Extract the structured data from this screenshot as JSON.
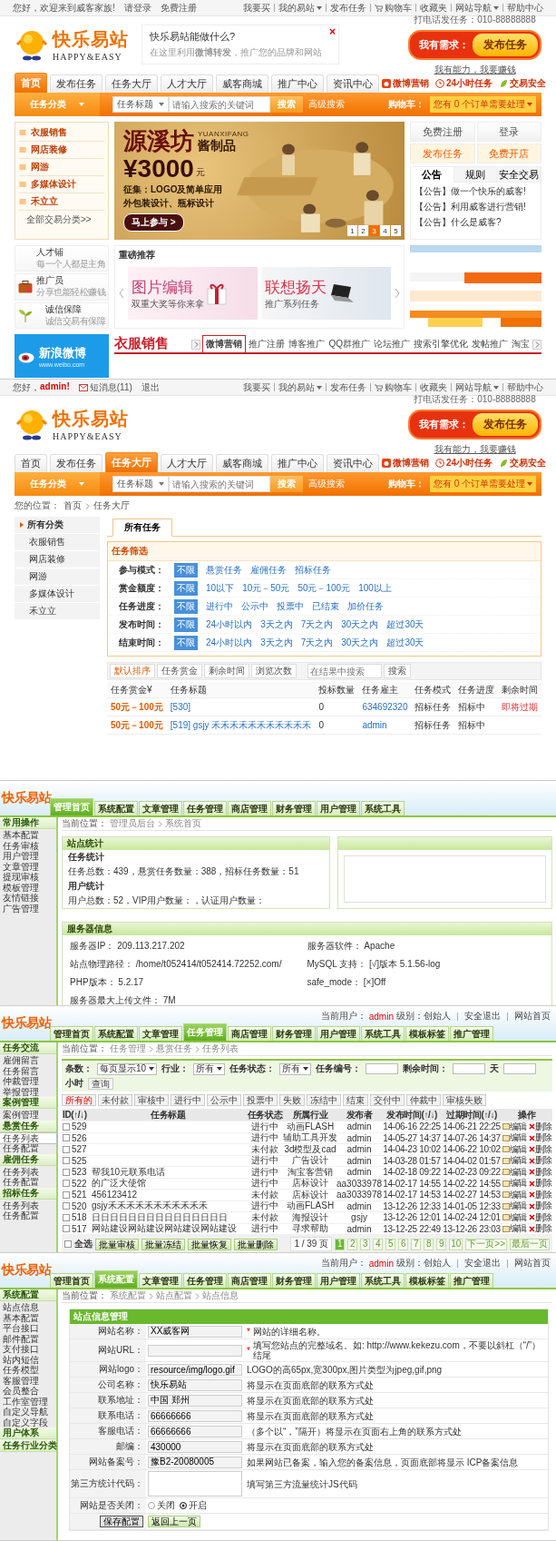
{
  "home_page": {
    "top_bar": {
      "greeting": "您好，欢迎来到威客家族!",
      "links": [
        "请登录",
        "免费注册"
      ]
    },
    "quick_links": [
      {
        "label": "我要买",
        "kind": "link",
        "dropdown": false
      },
      {
        "label": "我的易站",
        "kind": "link",
        "dropdown": true
      },
      {
        "label": "发布任务",
        "kind": "link",
        "dropdown": false
      },
      {
        "label": "购物车",
        "kind": "cart",
        "dropdown": false
      },
      {
        "label": "收藏夹",
        "kind": "link",
        "dropdown": false
      },
      {
        "label": "网站导航",
        "kind": "link",
        "dropdown": true
      },
      {
        "label": "帮助中心",
        "kind": "link",
        "dropdown": false
      }
    ],
    "header": {
      "logo": {
        "name": "快乐易站",
        "tagline": "HAPPY&EASY"
      },
      "notice": {
        "title": "快乐易站能做什么?",
        "close": "×",
        "text": "在这里利用**微博转发**，推广您的品牌和网站"
      },
      "hotline": "打电话发任务：010-88888888",
      "demand": {
        "label": "我有需求：",
        "button": "发布任务"
      },
      "earn_link": "我有能力，我要赚钱"
    },
    "nav": {
      "tabs": [
        {
          "label": "首页",
          "selected": true
        },
        {
          "label": "发布任务",
          "selected": false
        },
        {
          "label": "任务大厅",
          "selected": false
        },
        {
          "label": "人才大厅",
          "selected": false
        },
        {
          "label": "威客商城",
          "selected": false
        },
        {
          "label": "推广中心",
          "selected": false
        },
        {
          "label": "资讯中心",
          "selected": false
        }
      ],
      "badges": [
        {
          "label": "微博营销",
          "kind": "weibo"
        },
        {
          "label": "24小时任务",
          "kind": "clock"
        },
        {
          "label": "交易安全",
          "kind": "leaf"
        }
      ]
    },
    "search": {
      "category": "任务分类",
      "field_type": "任务标题",
      "placeholder": "请输入搜索的关键词",
      "button": "搜索",
      "advanced": "高级搜索",
      "cart_label": "购物车：",
      "cart_status": "您有 0 个订单需要处理"
    },
    "categories": {
      "items": [
        "衣服销售",
        "网店装修",
        "网游",
        "多媒体设计",
        "禾立立"
      ],
      "more": "全部交易分类>>"
    },
    "banner": {
      "title": "源溪坊",
      "romanized": "YUANXIFANG",
      "product": "酱制品",
      "prize": "¥3000",
      "unit": "元",
      "lines": [
        "征集：LOGO及简单应用",
        "外包装设计、瓶标设计"
      ],
      "cta": "马上参与 >",
      "pages": [
        {
          "label": "1",
          "selected": false
        },
        {
          "label": "2",
          "selected": false
        },
        {
          "label": "3",
          "selected": true
        },
        {
          "label": "4",
          "selected": false
        },
        {
          "label": "5",
          "selected": false
        }
      ]
    },
    "account_box": {
      "buttons": [
        {
          "label": "免费注册",
          "kind": "plain"
        },
        {
          "label": "登录",
          "kind": "plain"
        },
        {
          "label": "发布任务",
          "kind": "accent"
        },
        {
          "label": "免费开店",
          "kind": "accent"
        }
      ],
      "tabs": [
        {
          "label": "公告",
          "selected": true
        },
        {
          "label": "规则",
          "selected": false
        },
        {
          "label": "安全交易",
          "selected": false
        }
      ],
      "notices": [
        "【公告】做一个快乐的威客!",
        "【公告】利用威客进行营销!",
        "【公告】什么是威客?"
      ]
    },
    "features": [
      {
        "title": "人才铺",
        "subtitle": "每一个人都是主角",
        "kind": "blank"
      },
      {
        "title": "推广员",
        "subtitle": "分享也能轻松赚钱",
        "kind": "briefcase"
      },
      {
        "title": "诚信保障",
        "subtitle": "诚信交易有保障",
        "kind": "plant"
      }
    ],
    "recommend": {
      "title": "重磅推荐",
      "items": [
        {
          "title": "图片编辑",
          "subtitle": "双重大奖等你来拿",
          "kind": "gift"
        },
        {
          "title": "联想扬天",
          "subtitle": "推广系列任务",
          "kind": "laptop"
        }
      ]
    },
    "weibo": {
      "name": "新浪微博",
      "url": "www.weibo.com"
    },
    "category_strip": {
      "title": "衣服销售",
      "tabs": [
        {
          "label": "微博营销",
          "selected": true
        },
        {
          "label": "推广注册",
          "selected": false
        },
        {
          "label": "博客推广",
          "selected": false
        },
        {
          "label": "QQ群推广",
          "selected": false
        },
        {
          "label": "论坛推广",
          "selected": false
        },
        {
          "label": "搜索引擎优化",
          "selected": false
        },
        {
          "label": "发帖推广",
          "selected": false
        },
        {
          "label": "淘宝",
          "selected": false
        }
      ]
    }
  },
  "task_hall_page": {
    "top_bar": {
      "greeting": "您好，",
      "user": "admin!",
      "messages": "短消息(11)",
      "logout": "退出"
    },
    "quick_links": [
      {
        "label": "我要买",
        "kind": "link",
        "dropdown": false
      },
      {
        "label": "我的易站",
        "kind": "link",
        "dropdown": true
      },
      {
        "label": "发布任务",
        "kind": "link",
        "dropdown": false
      },
      {
        "label": "购物车",
        "kind": "cart",
        "dropdown": false
      },
      {
        "label": "收藏夹",
        "kind": "link",
        "dropdown": false
      },
      {
        "label": "网站导航",
        "kind": "link",
        "dropdown": true
      },
      {
        "label": "帮助中心",
        "kind": "link",
        "dropdown": false
      }
    ],
    "header": {
      "logo": {
        "name": "快乐易站",
        "tagline": "HAPPY&EASY"
      },
      "hotline": "打电话发任务：010-88888888",
      "demand": {
        "label": "我有需求：",
        "button": "发布任务"
      },
      "earn_link": "我有能力，我要赚钱"
    },
    "nav": {
      "tabs": [
        {
          "label": "首页",
          "selected": false
        },
        {
          "label": "发布任务",
          "selected": false
        },
        {
          "label": "任务大厅",
          "selected": true
        },
        {
          "label": "人才大厅",
          "selected": false
        },
        {
          "label": "威客商城",
          "selected": false
        },
        {
          "label": "推广中心",
          "selected": false
        },
        {
          "label": "资讯中心",
          "selected": false
        }
      ],
      "badges": [
        {
          "label": "微博营销",
          "kind": "weibo"
        },
        {
          "label": "24小时任务",
          "kind": "clock"
        },
        {
          "label": "交易安全",
          "kind": "leaf"
        }
      ]
    },
    "search": {
      "category": "任务分类",
      "field_type": "任务标题",
      "placeholder": "请输入搜索的关键词",
      "button": "搜索",
      "advanced": "高级搜索",
      "cart_label": "购物车：",
      "cart_status": "您有 0 个订单需要处理"
    },
    "breadcrumb": {
      "label": "您的位置：",
      "path": [
        "首页",
        "任务大厅"
      ]
    },
    "category_menu": {
      "all": "所有分类",
      "items": [
        "衣服销售",
        "网店装修",
        "网游",
        "多媒体设计",
        "禾立立"
      ]
    },
    "tabs": [
      {
        "label": "所有任务",
        "selected": true
      }
    ],
    "filter": {
      "title": "任务筛选",
      "rows": [
        {
          "label": "参与模式：",
          "options": [
            {
              "label": "不限",
              "selected": true
            },
            {
              "label": "悬赏任务",
              "selected": false
            },
            {
              "label": "雇佣任务",
              "selected": false
            },
            {
              "label": "招标任务",
              "selected": false
            }
          ]
        },
        {
          "label": "赏金额度：",
          "options": [
            {
              "label": "不限",
              "selected": true
            },
            {
              "label": "10以下",
              "selected": false
            },
            {
              "label": "10元－50元",
              "selected": false
            },
            {
              "label": "50元－100元",
              "selected": false
            },
            {
              "label": "100以上",
              "selected": false
            }
          ]
        },
        {
          "label": "任务进度：",
          "options": [
            {
              "label": "不限",
              "selected": true
            },
            {
              "label": "进行中",
              "selected": false
            },
            {
              "label": "公示中",
              "selected": false
            },
            {
              "label": "投票中",
              "selected": false
            },
            {
              "label": "已结束",
              "selected": false
            },
            {
              "label": "加价任务",
              "selected": false
            }
          ]
        },
        {
          "label": "发布时间：",
          "options": [
            {
              "label": "不限",
              "selected": true
            },
            {
              "label": "24小时以内",
              "selected": false
            },
            {
              "label": "3天之内",
              "selected": false
            },
            {
              "label": "7天之内",
              "selected": false
            },
            {
              "label": "30天之内",
              "selected": false
            },
            {
              "label": "超过30天",
              "selected": false
            }
          ]
        },
        {
          "label": "结束时间：",
          "options": [
            {
              "label": "不限",
              "selected": true
            },
            {
              "label": "24小时以内",
              "selected": false
            },
            {
              "label": "3天之内",
              "selected": false
            },
            {
              "label": "7天之内",
              "selected": false
            },
            {
              "label": "30天之内",
              "selected": false
            },
            {
              "label": "超过30天",
              "selected": false
            }
          ]
        }
      ]
    },
    "sort": {
      "options": [
        {
          "label": "默认排序",
          "selected": true
        },
        {
          "label": "任务赏金",
          "selected": false
        },
        {
          "label": "剩余时间",
          "selected": false
        },
        {
          "label": "浏览次数",
          "selected": false
        }
      ],
      "placeholder": "在结果中搜索",
      "button": "搜索"
    },
    "table": {
      "columns": [
        "任务赏金¥",
        "任务标题",
        "投标数量",
        "任务雇主",
        "任务模式",
        "任务进度",
        "剩余时间"
      ],
      "rows": [
        {
          "cells": [
            "50元－100元",
            "[530]",
            "0",
            "634692320",
            "招标任务",
            "招标中",
            "即将过期"
          ]
        },
        {
          "cells": [
            "50元－100元",
            "[519] gsjy 禾禾禾禾禾禾禾禾禾禾禾",
            "0",
            "admin",
            "招标任务",
            "招标中"
          ]
        }
      ]
    }
  },
  "admin_dashboard": {
    "header": {
      "logo": "快乐易站",
      "tabs": [
        {
          "label": "管理首页",
          "selected": true
        },
        {
          "label": "系统配置",
          "selected": false
        },
        {
          "label": "文章管理",
          "selected": false
        },
        {
          "label": "任务管理",
          "selected": false
        },
        {
          "label": "商店管理",
          "selected": false
        },
        {
          "label": "财务管理",
          "selected": false
        },
        {
          "label": "用户管理",
          "selected": false
        },
        {
          "label": "系统工具",
          "selected": false
        }
      ]
    },
    "breadcrumb": {
      "label": "当前位置：",
      "path": [
        "管理员后台",
        "系统首页"
      ]
    },
    "sidebar": {
      "title": "常用操作",
      "items": [
        "基本配置",
        "任务审核",
        "用户管理",
        "文章管理",
        "提现审核",
        "模板管理",
        "友情链接",
        "广告管理"
      ]
    },
    "stats": {
      "title": "站点统计",
      "groups": [
        {
          "title": "任务统计",
          "text": "任务总数：439，悬赏任务数量：388，招标任务数量：51"
        },
        {
          "title": "用户统计",
          "text": "用户总数：52，VIP用户数量：，认证用户数量："
        }
      ]
    },
    "server": {
      "title": "服务器信息",
      "items": [
        {
          "label": "服务器IP：",
          "value": "209.113.217.202"
        },
        {
          "label": "服务器软件：",
          "value": "Apache"
        },
        {
          "label": "站点物理路径：",
          "value": "/home/t052414/t052414.72252.com/"
        },
        {
          "label": "MySQL 支持：",
          "value": "[√]版本 5.1.56-log"
        },
        {
          "label": "PHP版本：",
          "value": "5.2.17"
        },
        {
          "label": "safe_mode：",
          "value": "[×]Off"
        },
        {
          "label": "服务器最大上传文件：",
          "value": "7M"
        }
      ]
    }
  },
  "admin_task_list": {
    "header": {
      "logo": "快乐易站",
      "tabs": [
        {
          "label": "管理首页",
          "selected": false
        },
        {
          "label": "系统配置",
          "selected": false
        },
        {
          "label": "文章管理",
          "selected": false
        },
        {
          "label": "任务管理",
          "selected": true
        },
        {
          "label": "商店管理",
          "selected": false
        },
        {
          "label": "财务管理",
          "selected": false
        },
        {
          "label": "用户管理",
          "selected": false
        },
        {
          "label": "系统工具",
          "selected": false
        },
        {
          "label": "模板标签",
          "selected": false
        },
        {
          "label": "推广管理",
          "selected": false
        }
      ],
      "user_info": {
        "label": "当前用户：",
        "user": "admin",
        "level": "级别：创始人",
        "links": [
          "安全退出",
          "网站首页"
        ]
      }
    },
    "breadcrumb": {
      "label": "当前位置：",
      "path": [
        "任务管理",
        "悬赏任务",
        "任务列表"
      ]
    },
    "sidebar": [
      {
        "title": "任务交流",
        "items": [
          {
            "label": "雇佣留言",
            "selected": false
          },
          {
            "label": "任务留言",
            "selected": false
          },
          {
            "label": "仲裁管理",
            "selected": false
          },
          {
            "label": "举报管理",
            "selected": false
          }
        ]
      },
      {
        "title": "案例管理",
        "items": [
          {
            "label": "案例管理",
            "selected": false
          }
        ]
      },
      {
        "title": "悬赏任务",
        "items": [
          {
            "label": "任务列表",
            "selected": true
          },
          {
            "label": "任务配置",
            "selected": false
          }
        ]
      },
      {
        "title": "雇佣任务",
        "items": [
          {
            "label": "任务列表",
            "selected": false
          },
          {
            "label": "任务配置",
            "selected": false
          }
        ]
      },
      {
        "title": "招标任务",
        "items": [
          {
            "label": "任务列表",
            "selected": false
          },
          {
            "label": "任务配置",
            "selected": false
          }
        ]
      }
    ],
    "filter": {
      "fields": [
        {
          "label": "条数：",
          "kind": "select",
          "value": "每页显示10"
        },
        {
          "label": "行业：",
          "kind": "select",
          "value": "所有"
        },
        {
          "label": "任务状态：",
          "kind": "select",
          "value": "所有"
        },
        {
          "label": "任务编号：",
          "kind": "input"
        },
        {
          "label": "剩余时间：",
          "kind": "input",
          "unit": "天"
        },
        {
          "kind": "input",
          "unit": "小时"
        }
      ],
      "button": "查询"
    },
    "statuses": [
      {
        "label": "所有的",
        "selected": true
      },
      {
        "label": "未付款",
        "selected": false
      },
      {
        "label": "审核中",
        "selected": false
      },
      {
        "label": "进行中",
        "selected": false
      },
      {
        "label": "公示中",
        "selected": false
      },
      {
        "label": "投票中",
        "selected": false
      },
      {
        "label": "失败",
        "selected": false
      },
      {
        "label": "冻结中",
        "selected": false
      },
      {
        "label": "结束",
        "selected": false
      },
      {
        "label": "交付中",
        "selected": false
      },
      {
        "label": "仲裁中",
        "selected": false
      },
      {
        "label": "审核失败",
        "selected": false
      }
    ],
    "table": {
      "columns": [
        "ID(↑/↓)",
        "任务标题",
        "任务状态",
        "所属行业",
        "发布者",
        "发布时间(↑/↓)",
        "过期时间(↑/↓)",
        "操作"
      ],
      "rows": [
        {
          "checked": false,
          "id": "529",
          "status": "进行中",
          "industry": "动画FLASH",
          "publisher": "admin",
          "published": "14-06-16 22:25",
          "expires": "14-06-21 22:25",
          "edit": "编辑",
          "delete": "删除"
        },
        {
          "checked": false,
          "id": "526",
          "status": "进行中",
          "industry": "辅助工具开发",
          "publisher": "admin",
          "published": "14-05-27 14:37",
          "expires": "14-07-26 14:37",
          "edit": "编辑",
          "delete": "删除"
        },
        {
          "checked": false,
          "id": "527",
          "status": "未付款",
          "industry": "3d模型及cad",
          "publisher": "admin",
          "published": "14-04-23 10:02",
          "expires": "14-06-22 10:02",
          "edit": "编辑",
          "delete": "删除"
        },
        {
          "checked": false,
          "id": "525",
          "status": "进行中",
          "industry": "广告设计",
          "publisher": "admin",
          "published": "14-03-28 01:57",
          "expires": "14-04-02 01:57",
          "edit": "编辑",
          "delete": "删除"
        },
        {
          "checked": false,
          "id": "523",
          "title": "帮我10元联系电话",
          "status": "进行中",
          "industry": "淘宝客营销",
          "publisher": "admin",
          "published": "14-02-18 09:22",
          "expires": "14-02-23 09:22",
          "edit": "编辑",
          "delete": "删除"
        },
        {
          "checked": false,
          "id": "522",
          "title": "的广泛大使馆",
          "status": "进行中",
          "industry": "店标设计",
          "publisher": "aa3033978",
          "published": "14-02-17 14:55",
          "expires": "14-02-22 14:55",
          "edit": "编辑",
          "delete": "删除"
        },
        {
          "checked": false,
          "id": "521",
          "title": "456123412",
          "status": "未付款",
          "industry": "店标设计",
          "publisher": "aa3033978",
          "published": "14-02-17 14:53",
          "expires": "14-02-27 14:53",
          "edit": "编辑",
          "delete": "删除"
        },
        {
          "checked": false,
          "id": "520",
          "title": "gsjy禾禾禾禾禾禾禾禾禾禾禾",
          "status": "进行中",
          "industry": "动画FLASH",
          "publisher": "admin",
          "published": "13-12-26 12:33",
          "expires": "14-01-05 12:33",
          "edit": "编辑",
          "delete": "删除"
        },
        {
          "checked": false,
          "id": "518",
          "title": "日日日日日日日日日日日日日日日",
          "status": "未付款",
          "industry": "海报设计",
          "publisher": "gsjy",
          "published": "13-12-26 12:01",
          "expires": "14-02-24 12:01",
          "edit": "编辑",
          "delete": "删除"
        },
        {
          "checked": false,
          "id": "517",
          "title": "网站建设网站建设网站建设网站建设",
          "status": "进行中",
          "industry": "寻求帮助",
          "publisher": "admin",
          "published": "13-12-25 22:49",
          "expires": "13-12-26 23:03",
          "edit": "编辑",
          "delete": "删除"
        }
      ]
    },
    "footer": {
      "select_all": {
        "label": "全选",
        "checked": false
      },
      "actions": [
        "批量审核",
        "批量冻结",
        "批量恢复",
        "批量删除"
      ],
      "page_info": "1 / 39 页",
      "pages": [
        {
          "label": "1",
          "selected": true
        },
        {
          "label": "2",
          "selected": false
        },
        {
          "label": "3",
          "selected": false
        },
        {
          "label": "4",
          "selected": false
        },
        {
          "label": "5",
          "selected": false
        },
        {
          "label": "6",
          "selected": false
        },
        {
          "label": "7",
          "selected": false
        },
        {
          "label": "8",
          "selected": false
        },
        {
          "label": "9",
          "selected": false
        },
        {
          "label": "10",
          "selected": false
        }
      ],
      "next": "下一页>>",
      "last": "最后一页"
    }
  },
  "admin_site_config": {
    "header": {
      "logo": "快乐易站",
      "tabs": [
        {
          "label": "管理首页",
          "selected": false
        },
        {
          "label": "系统配置",
          "selected": true
        },
        {
          "label": "文章管理",
          "selected": false
        },
        {
          "label": "任务管理",
          "selected": false
        },
        {
          "label": "商店管理",
          "selected": false
        },
        {
          "label": "财务管理",
          "selected": false
        },
        {
          "label": "用户管理",
          "selected": false
        },
        {
          "label": "系统工具",
          "selected": false
        },
        {
          "label": "模板标签",
          "selected": false
        },
        {
          "label": "推广管理",
          "selected": false
        }
      ],
      "user_info": {
        "label": "当前用户：",
        "user": "admin",
        "level": "级别：创始人",
        "links": [
          "安全退出",
          "网站首页"
        ]
      }
    },
    "breadcrumb": {
      "label": "当前位置：",
      "path": [
        "系统配置",
        "站点配置",
        "站点信息"
      ]
    },
    "sidebar": [
      {
        "title": "系统配置",
        "items": [
          "站点信息",
          "基本配置",
          "平台接口",
          "邮件配置",
          "支付接口",
          "站内短信",
          "任务模型",
          "客服管理",
          "会员整合",
          "工作室管理",
          "自定义导航",
          "自定义字段"
        ]
      },
      {
        "title": "用户体系"
      },
      {
        "title": "任务行业分类"
      }
    ],
    "form": {
      "title": "站点信息管理",
      "rows": [
        {
          "label": "网站名称：",
          "kind": "text",
          "value": "XX威客网",
          "mark": "*",
          "hint": "网站的详细名称。"
        },
        {
          "label": "网站URL：",
          "kind": "text",
          "mark": "*",
          "hint": "填写您站点的完整域名。如: http://www.kekezu.com，不要以斜杠（“/”）结尾"
        },
        {
          "label": "网站logo：",
          "kind": "text",
          "value": "resource/img/logo.gif",
          "hint": "LOGO的高65px,宽300px,图片类型为jpeg,gif,png"
        },
        {
          "label": "公司名称：",
          "kind": "text",
          "value": "快乐易站",
          "hint": "将显示在页面底部的联系方式处"
        },
        {
          "label": "联系地址：",
          "kind": "text",
          "value": "中国 郑州",
          "hint": "将显示在页面底部的联系方式处"
        },
        {
          "label": "联系电话：",
          "kind": "text",
          "value": "66666666",
          "hint": "将显示在页面底部的联系方式处"
        },
        {
          "label": "客服电话：",
          "kind": "text",
          "value": "66666666",
          "hint": "（多个以“，”隔开）将显示在页面右上角的联系方式处"
        },
        {
          "label": "邮编：",
          "kind": "text",
          "value": "430000",
          "hint": "将显示在页面底部的联系方式处"
        },
        {
          "label": "网站备案号：",
          "kind": "text",
          "value": "豫B2-20080005",
          "hint": "如果网站已备案，输入您的备案信息，页面底部将显示 ICP备案信息"
        },
        {
          "label": "第三方统计代码：",
          "kind": "textarea",
          "hint": "填写第三方流量统计JS代码"
        },
        {
          "label": "网站是否关闭：",
          "kind": "radio",
          "options": [
            {
              "label": "关闭",
              "selected": false
            },
            {
              "label": "开启",
              "selected": true
            }
          ]
        }
      ],
      "buttons": [
        "保存配置",
        "返回上一页"
      ]
    }
  }
}
